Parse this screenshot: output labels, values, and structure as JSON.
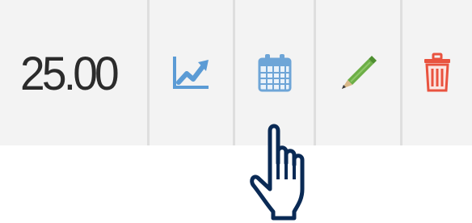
{
  "row": {
    "amount": "25.00",
    "actions": [
      {
        "name": "chart",
        "icon": "line-chart-icon",
        "color": "#5b9bd5"
      },
      {
        "name": "schedule",
        "icon": "calendar-icon",
        "color": "#6ea5d7"
      },
      {
        "name": "edit",
        "icon": "pencil-icon",
        "color": "#6cae46"
      },
      {
        "name": "delete",
        "icon": "trash-icon",
        "color": "#e9533f"
      }
    ]
  },
  "colors": {
    "row_bg": "#f3f3f3",
    "separator": "#dedede",
    "text": "#2b2b2b",
    "cursor_outline": "#0a2a55"
  },
  "cursor": {
    "icon": "hand-pointer-icon"
  }
}
